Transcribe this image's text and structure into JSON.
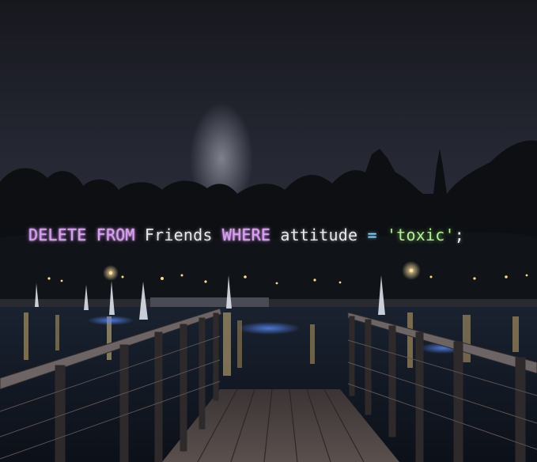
{
  "overlay": {
    "tokens": [
      {
        "text": "DELETE",
        "kind": "keyword"
      },
      {
        "text": " ",
        "kind": "space"
      },
      {
        "text": "FROM",
        "kind": "keyword"
      },
      {
        "text": " ",
        "kind": "space"
      },
      {
        "text": "Friends",
        "kind": "ident"
      },
      {
        "text": " ",
        "kind": "space"
      },
      {
        "text": "WHERE",
        "kind": "keyword"
      },
      {
        "text": " ",
        "kind": "space"
      },
      {
        "text": "attitude",
        "kind": "ident"
      },
      {
        "text": " ",
        "kind": "space"
      },
      {
        "text": "=",
        "kind": "op"
      },
      {
        "text": " ",
        "kind": "space"
      },
      {
        "text": "'toxic'",
        "kind": "string"
      },
      {
        "text": ";",
        "kind": "punct"
      }
    ]
  },
  "colors": {
    "keyword": "#d9a0f0",
    "identifier": "#e8e8ee",
    "operator": "#8fd7ff",
    "string": "#b4ef9a",
    "sky": "#1c1d24",
    "water": "#10141d",
    "lights": "#ffd98a"
  }
}
